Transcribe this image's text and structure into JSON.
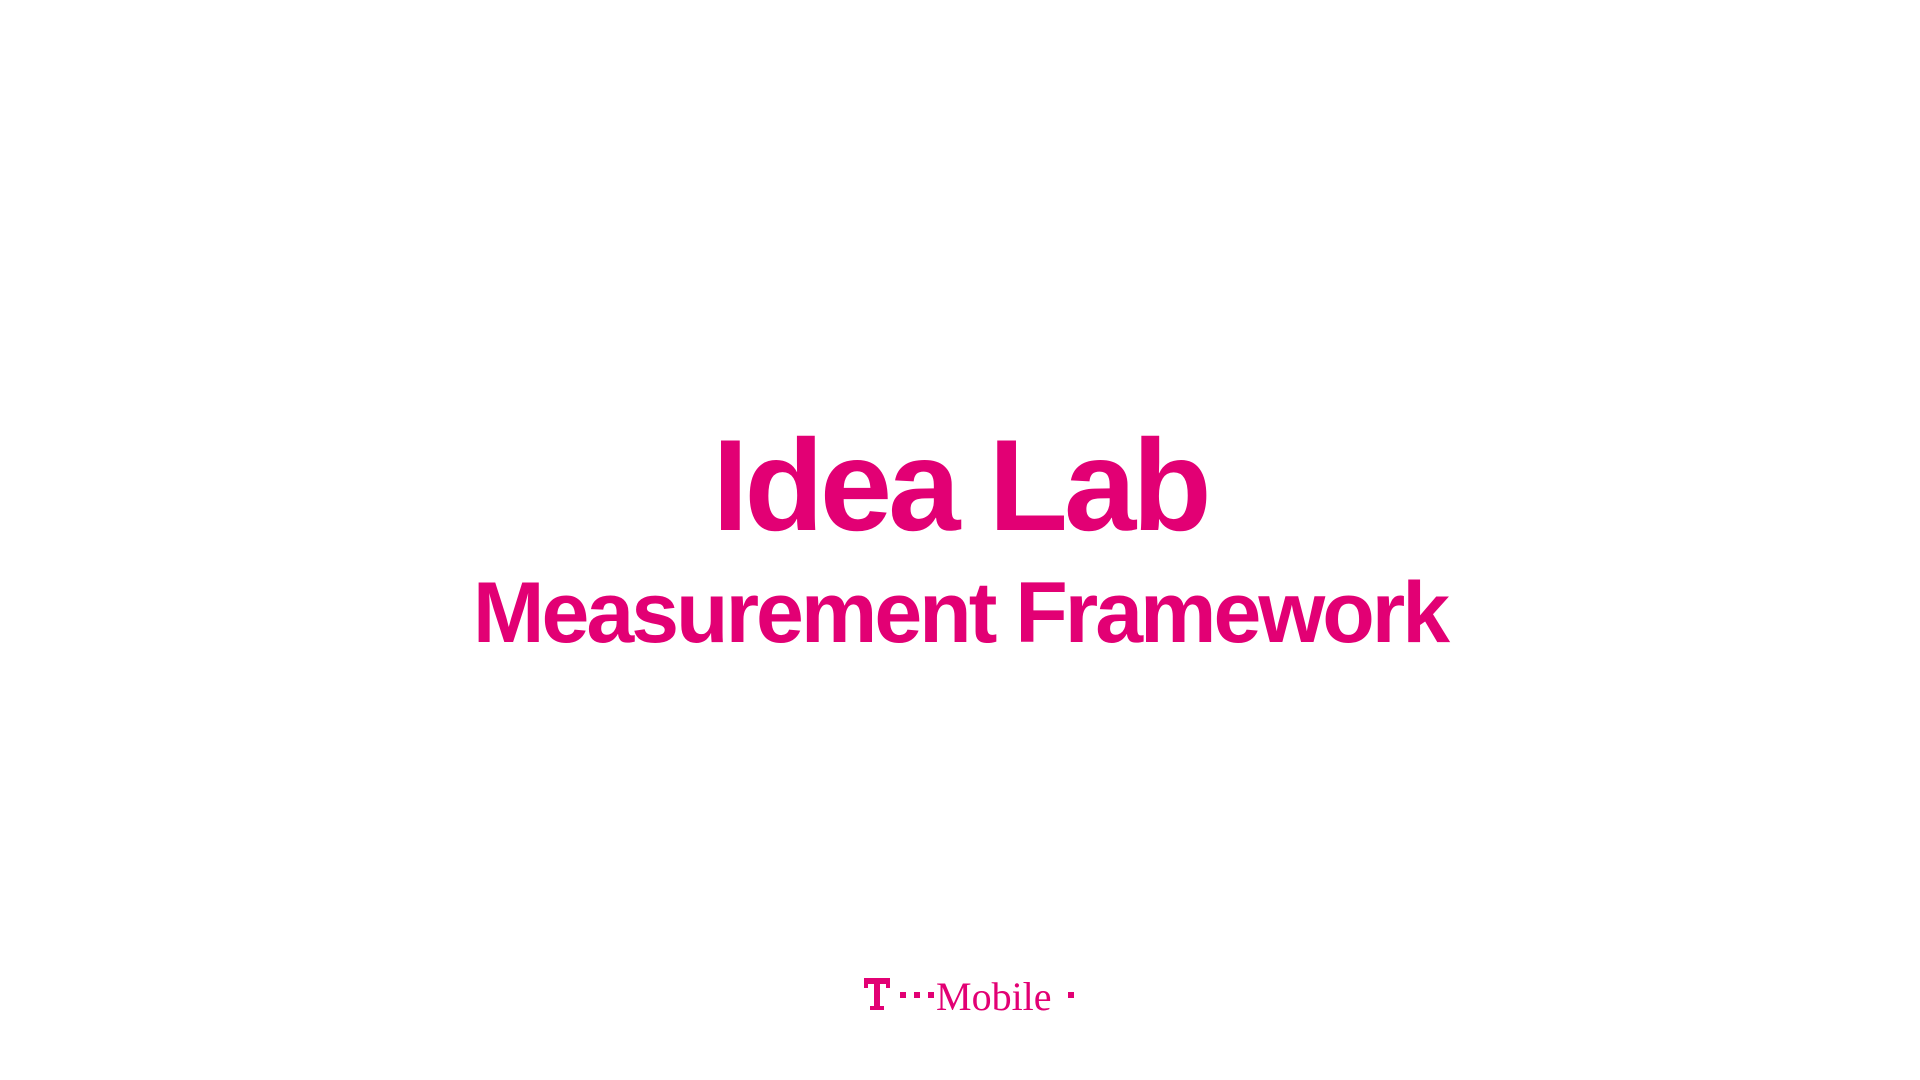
{
  "colors": {
    "brand": "#E20074",
    "background": "#FFFFFF"
  },
  "slide": {
    "title": "Idea Lab",
    "subtitle": "Measurement Framework"
  },
  "footer": {
    "logo_text": "T · · Mobile ·",
    "logo_icon": "t-mobile-logo"
  }
}
